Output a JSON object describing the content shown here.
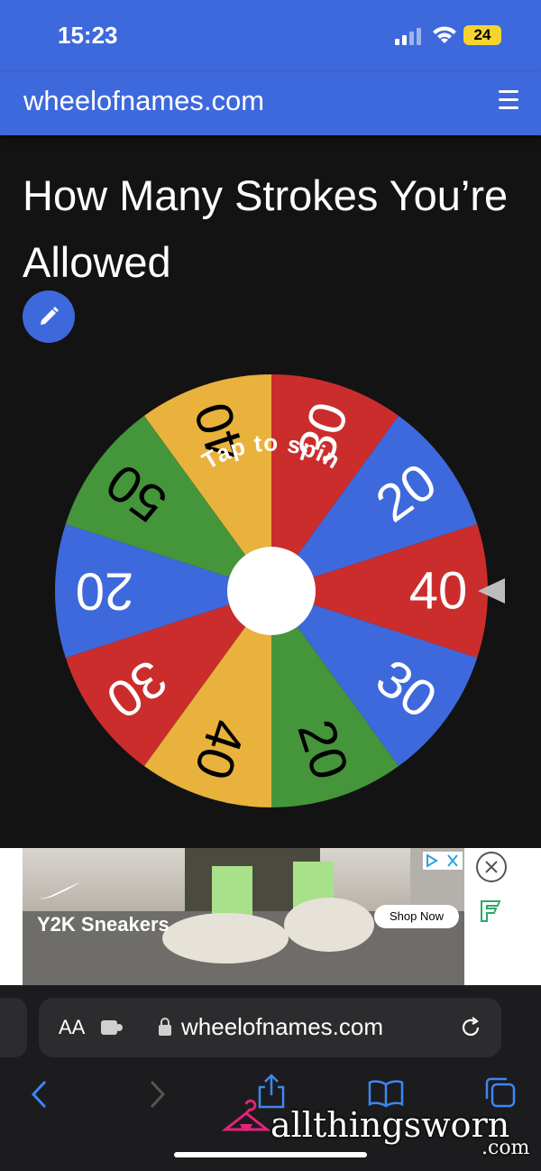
{
  "status": {
    "time": "15:23",
    "battery": "24"
  },
  "header": {
    "site": "wheelofnames.com"
  },
  "page": {
    "title": "How Many Strokes You’re Allowed"
  },
  "wheel": {
    "center_label": "Tap to spin",
    "segments": [
      {
        "label": "40",
        "color": "#e8b23c"
      },
      {
        "label": "30",
        "color": "#cb2d2d"
      },
      {
        "label": "20",
        "color": "#3e69dc"
      },
      {
        "label": "40",
        "color": "#cb2d2d"
      },
      {
        "label": "30",
        "color": "#3e69dc"
      },
      {
        "label": "20",
        "color": "#45953a"
      },
      {
        "label": "40",
        "color": "#e8b23c"
      },
      {
        "label": "30",
        "color": "#cb2d2d"
      },
      {
        "label": "20",
        "color": "#3e69dc"
      },
      {
        "label": "50",
        "color": "#45953a"
      }
    ]
  },
  "ad": {
    "headline": "Y2K Sneakers",
    "cta": "Shop Now"
  },
  "browser": {
    "aa": "AA",
    "url": "wheelofnames.com"
  },
  "watermark": {
    "name": "allthingsworn",
    "suffix": ".com"
  }
}
